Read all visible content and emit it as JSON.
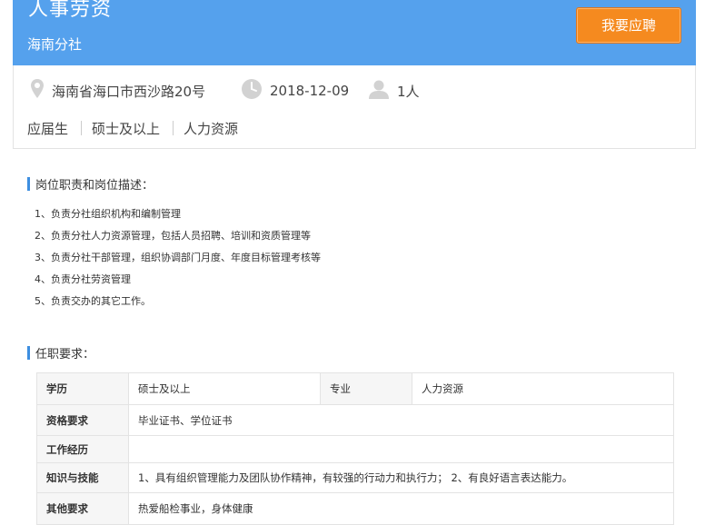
{
  "header": {
    "job_title": "人事劳资",
    "branch": "海南分社",
    "apply_label": "我要应聘"
  },
  "meta": {
    "location": "海南省海口市西沙路20号",
    "date": "2018-12-09",
    "headcount": "1人"
  },
  "tags": [
    "应届生",
    "硕士及以上",
    "人力资源"
  ],
  "duties_section": {
    "title": "岗位职责和岗位描述：",
    "items": [
      "1、负责分社组织机构和编制管理",
      "2、负责分社人力资源管理，包括人员招聘、培训和资质管理等",
      "3、负责分社干部管理，组织协调部门月度、年度目标管理考核等",
      "4、负责分社劳资管理",
      "5、负责交办的其它工作。"
    ]
  },
  "requirements_section": {
    "title": "任职要求：",
    "education_label": "学历",
    "education_value": "硕士及以上",
    "major_label": "专业",
    "major_value": "人力资源",
    "qualification_label": "资格要求",
    "qualification_value": "毕业证书、学位证书",
    "experience_label": "工作经历",
    "experience_value": "",
    "skills_label": "知识与技能",
    "skills_value": "1、具有组织管理能力及团队协作精神，有较强的行动力和执行力； 2、有良好语言表达能力。",
    "other_label": "其他要求",
    "other_value": "热爱船检事业，身体健康"
  },
  "colors": {
    "header_bg": "#55a1ed",
    "apply_bg": "#f58a1f",
    "section_bar": "#3d8ee0"
  },
  "icons": [
    "location-pin-icon",
    "clock-icon",
    "person-icon"
  ]
}
